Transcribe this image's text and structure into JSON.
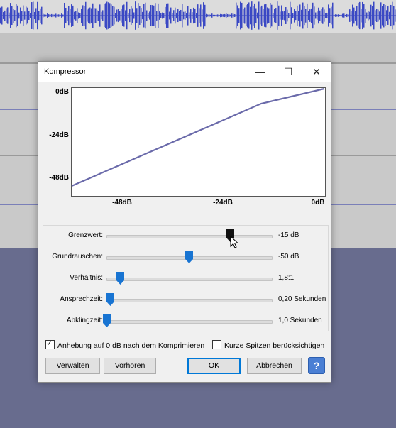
{
  "window": {
    "title": "Kompressor"
  },
  "titlebar_glyphs": {
    "minimize": "—",
    "maximize": "☐",
    "close": "✕"
  },
  "graph": {
    "y_labels": [
      "0dB",
      "-24dB",
      "-48dB"
    ],
    "x_labels": [
      "-48dB",
      "-24dB",
      "0dB"
    ],
    "line_color": "#6a6aaa"
  },
  "sliders": [
    {
      "label": "Grenzwert:",
      "value": "-15 dB",
      "position": 0.75
    },
    {
      "label": "Grundrauschen:",
      "value": "-50 dB",
      "position": 0.5
    },
    {
      "label": "Verhältnis:",
      "value": "1,8:1",
      "position": 0.08
    },
    {
      "label": "Ansprechzeit:",
      "value": "0,20 Sekunden",
      "position": 0.02
    },
    {
      "label": "Abklingzeit:",
      "value": "1,0 Sekunden",
      "position": 0.0
    }
  ],
  "options": {
    "makeup_gain": {
      "label": "Anhebung auf 0 dB nach dem Komprimieren",
      "checked": true
    },
    "peaks": {
      "label": "Kurze Spitzen berücksichtigen",
      "checked": false
    }
  },
  "buttons": {
    "manage": "Verwalten",
    "preview": "Vorhören",
    "ok": "OK",
    "cancel": "Abbrechen",
    "help": "?"
  }
}
